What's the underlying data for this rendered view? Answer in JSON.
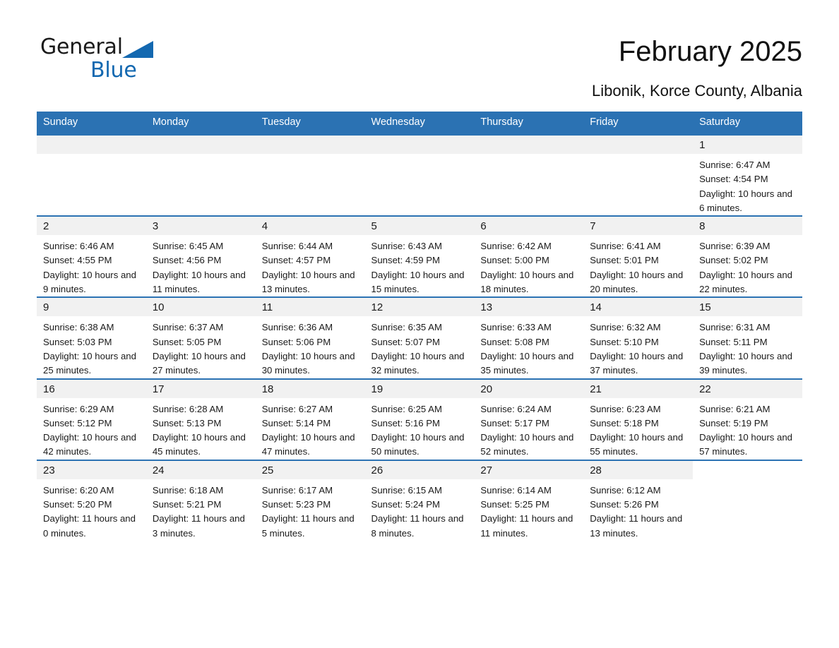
{
  "brand": {
    "name_part1": "General",
    "name_part2": "Blue",
    "triangle_color": "#1368b0",
    "accent_color": "#2b72b3"
  },
  "header": {
    "month_title": "February 2025",
    "location": "Libonik, Korce County, Albania"
  },
  "weekday_headers": [
    "Sunday",
    "Monday",
    "Tuesday",
    "Wednesday",
    "Thursday",
    "Friday",
    "Saturday"
  ],
  "labels": {
    "sunrise_prefix": "Sunrise:",
    "sunset_prefix": "Sunset:",
    "daylight_prefix": "Daylight:"
  },
  "weeks": [
    [
      {
        "date": "",
        "empty": true
      },
      {
        "date": "",
        "empty": true
      },
      {
        "date": "",
        "empty": true
      },
      {
        "date": "",
        "empty": true
      },
      {
        "date": "",
        "empty": true
      },
      {
        "date": "",
        "empty": true
      },
      {
        "date": "1",
        "sunrise": "Sunrise: 6:47 AM",
        "sunset": "Sunset: 4:54 PM",
        "daylight": "Daylight: 10 hours and 6 minutes."
      }
    ],
    [
      {
        "date": "2",
        "sunrise": "Sunrise: 6:46 AM",
        "sunset": "Sunset: 4:55 PM",
        "daylight": "Daylight: 10 hours and 9 minutes."
      },
      {
        "date": "3",
        "sunrise": "Sunrise: 6:45 AM",
        "sunset": "Sunset: 4:56 PM",
        "daylight": "Daylight: 10 hours and 11 minutes."
      },
      {
        "date": "4",
        "sunrise": "Sunrise: 6:44 AM",
        "sunset": "Sunset: 4:57 PM",
        "daylight": "Daylight: 10 hours and 13 minutes."
      },
      {
        "date": "5",
        "sunrise": "Sunrise: 6:43 AM",
        "sunset": "Sunset: 4:59 PM",
        "daylight": "Daylight: 10 hours and 15 minutes."
      },
      {
        "date": "6",
        "sunrise": "Sunrise: 6:42 AM",
        "sunset": "Sunset: 5:00 PM",
        "daylight": "Daylight: 10 hours and 18 minutes."
      },
      {
        "date": "7",
        "sunrise": "Sunrise: 6:41 AM",
        "sunset": "Sunset: 5:01 PM",
        "daylight": "Daylight: 10 hours and 20 minutes."
      },
      {
        "date": "8",
        "sunrise": "Sunrise: 6:39 AM",
        "sunset": "Sunset: 5:02 PM",
        "daylight": "Daylight: 10 hours and 22 minutes."
      }
    ],
    [
      {
        "date": "9",
        "sunrise": "Sunrise: 6:38 AM",
        "sunset": "Sunset: 5:03 PM",
        "daylight": "Daylight: 10 hours and 25 minutes."
      },
      {
        "date": "10",
        "sunrise": "Sunrise: 6:37 AM",
        "sunset": "Sunset: 5:05 PM",
        "daylight": "Daylight: 10 hours and 27 minutes."
      },
      {
        "date": "11",
        "sunrise": "Sunrise: 6:36 AM",
        "sunset": "Sunset: 5:06 PM",
        "daylight": "Daylight: 10 hours and 30 minutes."
      },
      {
        "date": "12",
        "sunrise": "Sunrise: 6:35 AM",
        "sunset": "Sunset: 5:07 PM",
        "daylight": "Daylight: 10 hours and 32 minutes."
      },
      {
        "date": "13",
        "sunrise": "Sunrise: 6:33 AM",
        "sunset": "Sunset: 5:08 PM",
        "daylight": "Daylight: 10 hours and 35 minutes."
      },
      {
        "date": "14",
        "sunrise": "Sunrise: 6:32 AM",
        "sunset": "Sunset: 5:10 PM",
        "daylight": "Daylight: 10 hours and 37 minutes."
      },
      {
        "date": "15",
        "sunrise": "Sunrise: 6:31 AM",
        "sunset": "Sunset: 5:11 PM",
        "daylight": "Daylight: 10 hours and 39 minutes."
      }
    ],
    [
      {
        "date": "16",
        "sunrise": "Sunrise: 6:29 AM",
        "sunset": "Sunset: 5:12 PM",
        "daylight": "Daylight: 10 hours and 42 minutes."
      },
      {
        "date": "17",
        "sunrise": "Sunrise: 6:28 AM",
        "sunset": "Sunset: 5:13 PM",
        "daylight": "Daylight: 10 hours and 45 minutes."
      },
      {
        "date": "18",
        "sunrise": "Sunrise: 6:27 AM",
        "sunset": "Sunset: 5:14 PM",
        "daylight": "Daylight: 10 hours and 47 minutes."
      },
      {
        "date": "19",
        "sunrise": "Sunrise: 6:25 AM",
        "sunset": "Sunset: 5:16 PM",
        "daylight": "Daylight: 10 hours and 50 minutes."
      },
      {
        "date": "20",
        "sunrise": "Sunrise: 6:24 AM",
        "sunset": "Sunset: 5:17 PM",
        "daylight": "Daylight: 10 hours and 52 minutes."
      },
      {
        "date": "21",
        "sunrise": "Sunrise: 6:23 AM",
        "sunset": "Sunset: 5:18 PM",
        "daylight": "Daylight: 10 hours and 55 minutes."
      },
      {
        "date": "22",
        "sunrise": "Sunrise: 6:21 AM",
        "sunset": "Sunset: 5:19 PM",
        "daylight": "Daylight: 10 hours and 57 minutes."
      }
    ],
    [
      {
        "date": "23",
        "sunrise": "Sunrise: 6:20 AM",
        "sunset": "Sunset: 5:20 PM",
        "daylight": "Daylight: 11 hours and 0 minutes."
      },
      {
        "date": "24",
        "sunrise": "Sunrise: 6:18 AM",
        "sunset": "Sunset: 5:21 PM",
        "daylight": "Daylight: 11 hours and 3 minutes."
      },
      {
        "date": "25",
        "sunrise": "Sunrise: 6:17 AM",
        "sunset": "Sunset: 5:23 PM",
        "daylight": "Daylight: 11 hours and 5 minutes."
      },
      {
        "date": "26",
        "sunrise": "Sunrise: 6:15 AM",
        "sunset": "Sunset: 5:24 PM",
        "daylight": "Daylight: 11 hours and 8 minutes."
      },
      {
        "date": "27",
        "sunrise": "Sunrise: 6:14 AM",
        "sunset": "Sunset: 5:25 PM",
        "daylight": "Daylight: 11 hours and 11 minutes."
      },
      {
        "date": "28",
        "sunrise": "Sunrise: 6:12 AM",
        "sunset": "Sunset: 5:26 PM",
        "daylight": "Daylight: 11 hours and 13 minutes."
      },
      {
        "date": "",
        "empty": true,
        "no_band": true
      }
    ]
  ]
}
